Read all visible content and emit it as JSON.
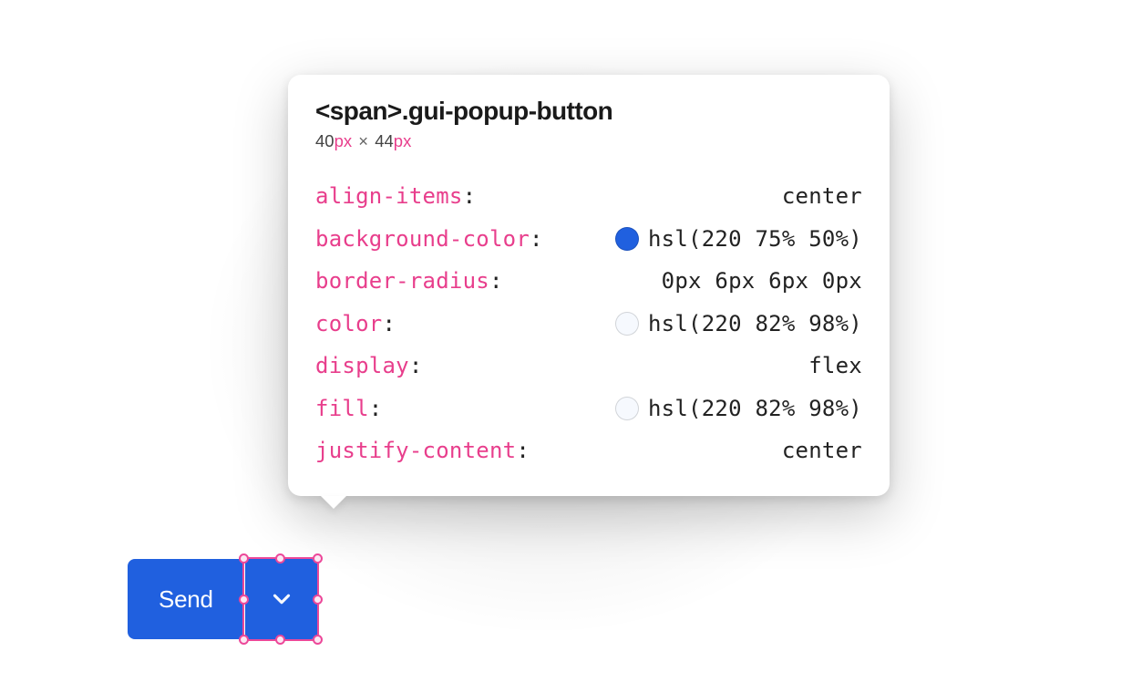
{
  "tooltip": {
    "selector": "<span>.gui-popup-button",
    "dimensions": {
      "width": "40",
      "height": "44",
      "unit": "px",
      "separator": "×"
    },
    "properties": [
      {
        "name": "align-items",
        "value": "center",
        "swatch": null
      },
      {
        "name": "background-color",
        "value": "hsl(220 75% 50%)",
        "swatch": "hsl(220, 75%, 50%)"
      },
      {
        "name": "border-radius",
        "value": "0px 6px 6px 0px",
        "swatch": null
      },
      {
        "name": "color",
        "value": "hsl(220 82% 98%)",
        "swatch": "hsl(220, 82%, 98%)"
      },
      {
        "name": "display",
        "value": "flex",
        "swatch": null
      },
      {
        "name": "fill",
        "value": "hsl(220 82% 98%)",
        "swatch": "hsl(220, 82%, 98%)"
      },
      {
        "name": "justify-content",
        "value": "center",
        "swatch": null
      }
    ]
  },
  "button": {
    "main_label": "Send",
    "popup_icon": "chevron-down"
  },
  "colors": {
    "accent": "hsl(220, 75%, 50%)",
    "accent_text": "hsl(220, 82%, 98%)",
    "css_property": "#e83e8c",
    "selection": "#ec4899"
  }
}
